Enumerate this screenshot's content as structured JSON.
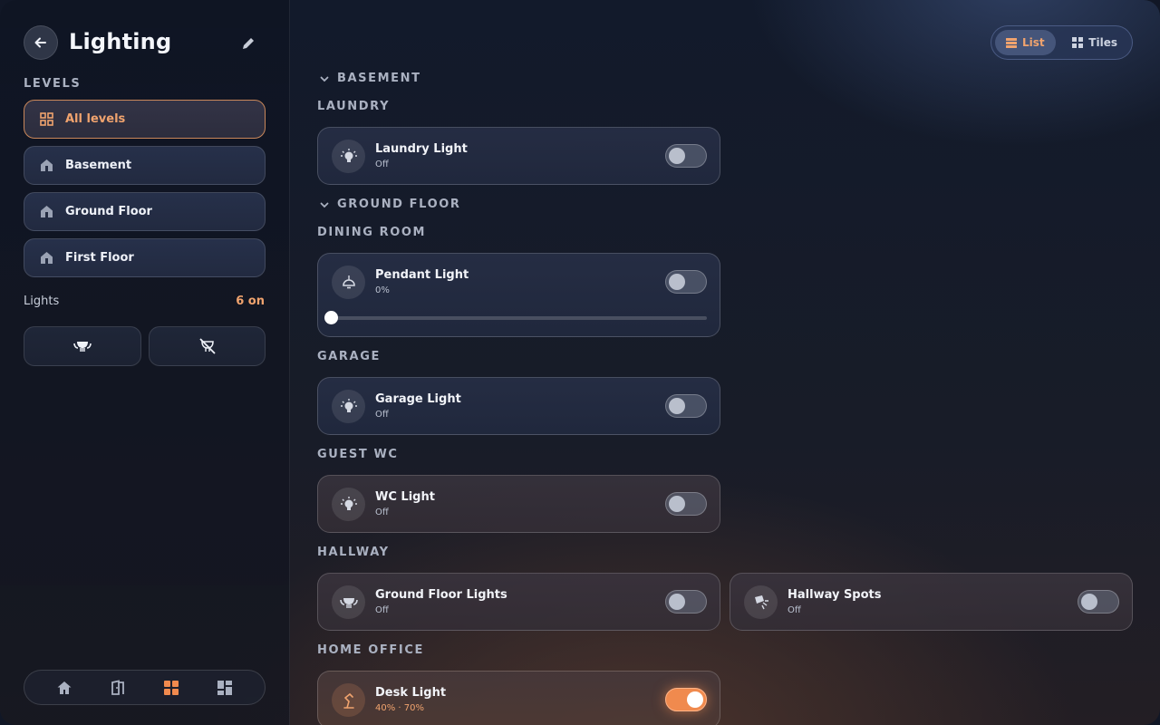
{
  "sidebar": {
    "title": "Lighting",
    "levels_label": "LEVELS",
    "levels": [
      {
        "label": "All levels",
        "active": true,
        "icon": "grid-icon"
      },
      {
        "label": "Basement",
        "active": false,
        "icon": "home-level-icon"
      },
      {
        "label": "Ground Floor",
        "active": false,
        "icon": "home-level-icon"
      },
      {
        "label": "First Floor",
        "active": false,
        "icon": "home-level-icon"
      }
    ],
    "lights_label": "Lights",
    "lights_count": "6 on",
    "actions": [
      {
        "icon": "lights-on-icon"
      },
      {
        "icon": "lights-off-icon"
      }
    ],
    "bottom_nav": [
      {
        "icon": "home-icon"
      },
      {
        "icon": "door-icon"
      },
      {
        "icon": "grid-icon",
        "active": true
      },
      {
        "icon": "dashboard-icon"
      }
    ]
  },
  "view_toggle": {
    "list_label": "List",
    "tiles_label": "Tiles",
    "active": "List"
  },
  "groups": [
    {
      "label": "BASEMENT",
      "rooms": [
        {
          "name": "LAUNDRY",
          "lights": [
            {
              "name": "Laundry Light",
              "state": "Off",
              "on": false,
              "icon": "bulb-icon"
            }
          ]
        }
      ]
    },
    {
      "label": "GROUND FLOOR",
      "rooms": [
        {
          "name": "DINING ROOM",
          "lights": [
            {
              "name": "Pendant Light",
              "state": "0%",
              "on": false,
              "icon": "pendant-icon",
              "brightness": 0
            }
          ]
        },
        {
          "name": "GARAGE",
          "lights": [
            {
              "name": "Garage Light",
              "state": "Off",
              "on": false,
              "icon": "bulb-icon"
            }
          ]
        },
        {
          "name": "GUEST WC",
          "lights": [
            {
              "name": "WC Light",
              "state": "Off",
              "on": false,
              "icon": "bulb-icon"
            }
          ]
        },
        {
          "name": "HALLWAY",
          "lights": [
            {
              "name": "Ground Floor Lights",
              "state": "Off",
              "on": false,
              "icon": "light-group-icon"
            },
            {
              "name": "Hallway Spots",
              "state": "Off",
              "on": false,
              "icon": "spotlight-icon"
            }
          ]
        },
        {
          "name": "HOME OFFICE",
          "lights": [
            {
              "name": "Desk Light",
              "state": "40% · 70%",
              "on": true,
              "icon": "desk-lamp-icon"
            }
          ]
        }
      ]
    }
  ],
  "colors": {
    "accent": "#f0a36e",
    "toggle_on": "#f08a4e"
  }
}
